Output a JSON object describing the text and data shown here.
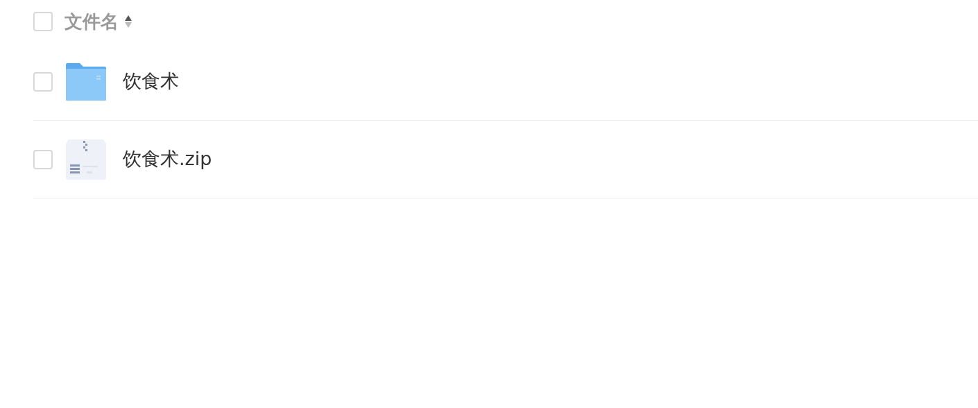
{
  "header": {
    "select_all_checked": false,
    "column_label": "文件名",
    "sort_ascending": true
  },
  "files": [
    {
      "kind": "folder",
      "name": "饮食术",
      "checked": false
    },
    {
      "kind": "zip",
      "name": "饮食术.zip",
      "checked": false
    }
  ]
}
